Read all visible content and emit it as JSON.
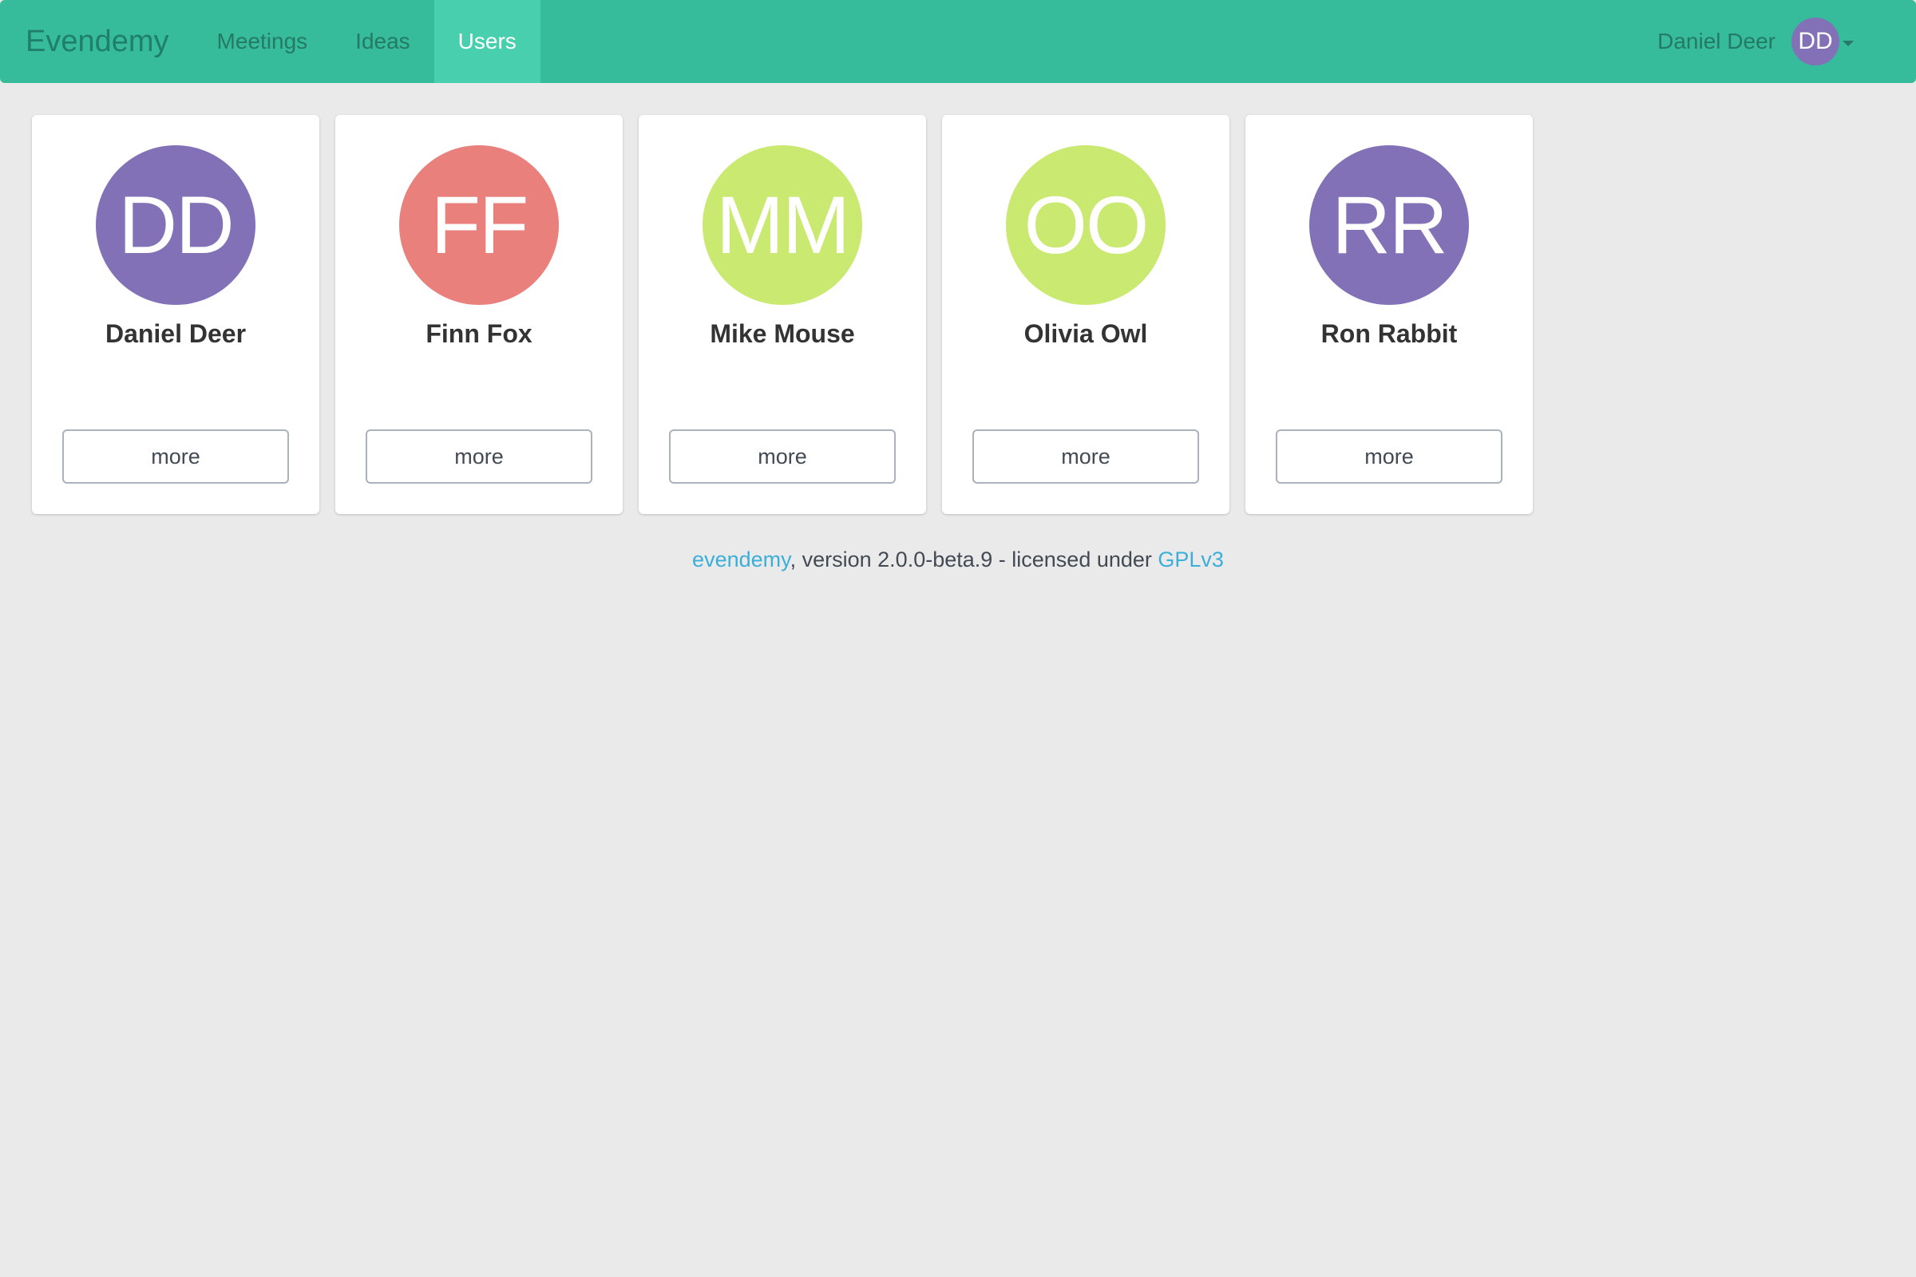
{
  "navbar": {
    "brand": "Evendemy",
    "links": [
      {
        "label": "Meetings",
        "active": false
      },
      {
        "label": "Ideas",
        "active": false
      },
      {
        "label": "Users",
        "active": true
      }
    ],
    "user": {
      "name": "Daniel Deer",
      "initials": "DD",
      "avatar_color": "#8271b6"
    }
  },
  "users": [
    {
      "initials": "DD",
      "name": "Daniel Deer",
      "color": "#8271b6",
      "button_label": "more"
    },
    {
      "initials": "FF",
      "name": "Finn Fox",
      "color": "#e9807c",
      "button_label": "more"
    },
    {
      "initials": "MM",
      "name": "Mike Mouse",
      "color": "#c9e970",
      "button_label": "more"
    },
    {
      "initials": "OO",
      "name": "Olivia Owl",
      "color": "#c9e970",
      "button_label": "more"
    },
    {
      "initials": "RR",
      "name": "Ron Rabbit",
      "color": "#8271b6",
      "button_label": "more"
    }
  ],
  "footer": {
    "app_link": "evendemy",
    "version_text": ", version 2.0.0-beta.9 - licensed under ",
    "license_link": "GPLv3"
  },
  "colors": {
    "navbar": "#36bc9b",
    "nav_active": "#48cfad",
    "link": "#3bafda",
    "background": "#eaeaea"
  }
}
